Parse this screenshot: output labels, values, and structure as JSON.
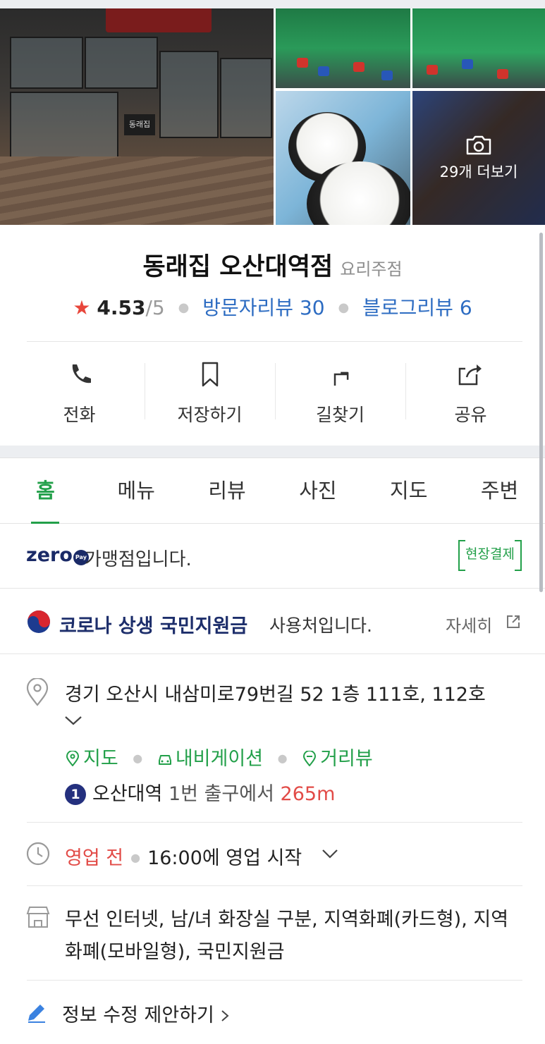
{
  "photos": {
    "more_label": "29개 더보기",
    "sign_text": "동래집"
  },
  "place": {
    "name": "동래집 오산대역점",
    "category": "요리주점",
    "star": "★",
    "rating": "4.53",
    "rating_max": "/5",
    "visitor_reviews": "방문자리뷰 30",
    "blog_reviews": "블로그리뷰 6"
  },
  "actions": {
    "call": "전화",
    "save": "저장하기",
    "directions": "길찾기",
    "share": "공유"
  },
  "tabs": [
    "홈",
    "메뉴",
    "리뷰",
    "사진",
    "지도",
    "주변"
  ],
  "zero_pay": {
    "logo": "zero",
    "logo_sub": "Pay",
    "text": "가맹점입니다.",
    "badge": "현장결제"
  },
  "corona": {
    "bold": "코로나 상생 국민지원금",
    "rest": "사용처입니다.",
    "detail": "자세히"
  },
  "address": {
    "text": "경기 오산시 내삼미로79번길 52 1층 111호, 112호",
    "links": {
      "map": "지도",
      "navigation": "내비게이션",
      "street_view": "거리뷰"
    },
    "subway": {
      "line": "1",
      "station": "오산대역",
      "exit": "1번 출구에서",
      "distance": "265m"
    }
  },
  "hours": {
    "status": "영업 전",
    "text": "16:00에 영업 시작"
  },
  "amenities": {
    "text": "무선 인터넷, 남/녀 화장실 구분, 지역화폐(카드형), 지역화폐(모바일형), 국민지원금"
  },
  "edit": {
    "label": "정보 수정 제안하기"
  },
  "colors": {
    "green": "#23a04a",
    "blue": "#2d6cc2",
    "red": "#e24b47",
    "navy": "#1d2e6b"
  }
}
